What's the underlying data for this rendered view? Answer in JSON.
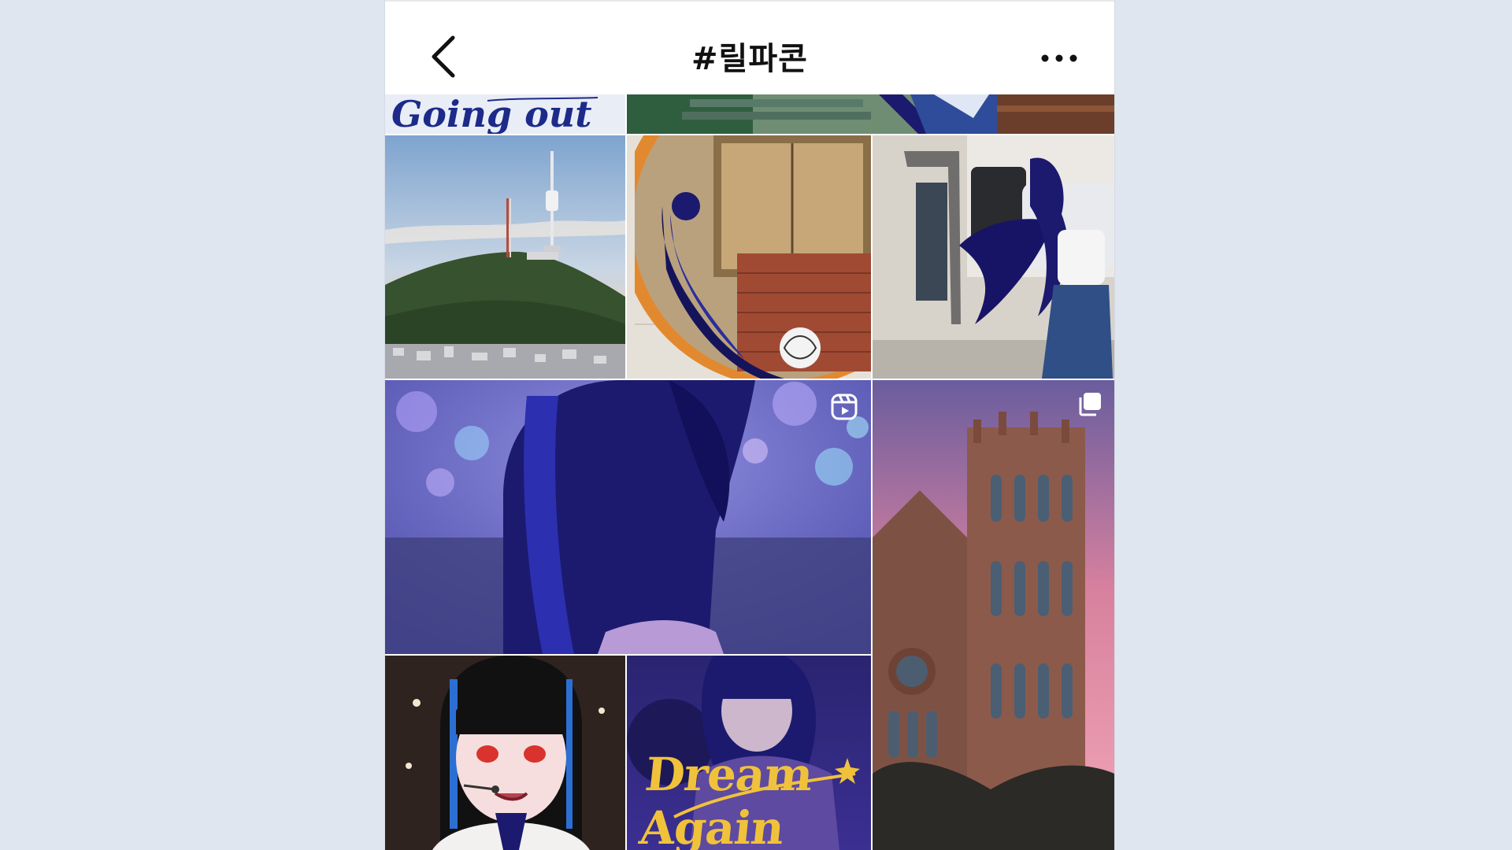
{
  "header": {
    "title": "#릴파콘",
    "back_icon": "chevron-left-icon",
    "more_icon": "more-horizontal-icon"
  },
  "tiles": {
    "going_out": {
      "text": "Going out"
    },
    "dream_again": {
      "text": "Dream Again"
    }
  },
  "badges": {
    "reel": "reels-icon",
    "carousel": "carousel-icon"
  },
  "colors": {
    "page_bg": "#dfe6f0",
    "bar_bg": "#ffffff",
    "accent_gold": "#f0c23b",
    "hair_navy": "#1c1a6e"
  }
}
